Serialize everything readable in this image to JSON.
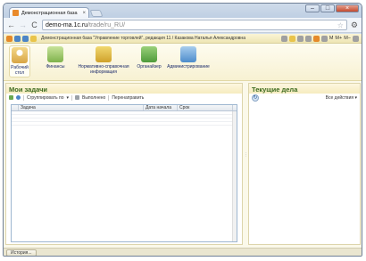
{
  "browser": {
    "tab_title": "Демонстрационная база",
    "tab_close": "×",
    "window_controls": {
      "minimize": "–",
      "maximize": "□",
      "close": "×"
    },
    "nav": {
      "back": "←",
      "forward": "→",
      "reload": "C"
    },
    "address": {
      "host": "demo-ma.1c.ru",
      "path": "/trade/ru_RU/"
    },
    "star": "☆",
    "menu": "⚙"
  },
  "app": {
    "title": "Демонстрационная база \"Управление торговлей\", редакция 11 / Казакова Наталья Александровна",
    "tool_letters": [
      "M",
      "M+",
      "M−"
    ],
    "sections": [
      {
        "id": "desk",
        "label": "Рабочий стол",
        "active": true
      },
      {
        "id": "fin",
        "label": "Финансы",
        "active": false
      },
      {
        "id": "ref",
        "label": "Нормативно-справочная информация",
        "active": false
      },
      {
        "id": "org",
        "label": "Органайзер",
        "active": false
      },
      {
        "id": "adm",
        "label": "Администрирование",
        "active": false
      }
    ]
  },
  "tasks": {
    "title": "Мои задачи",
    "group_by": "Сгруппировать по",
    "done": "Выполнено",
    "redirect": "Перенаправить",
    "columns": [
      "Задача",
      "Дата начала",
      "Срок"
    ]
  },
  "current": {
    "title": "Текущие дела",
    "all_actions": "Все действия"
  },
  "status": {
    "history": "История..."
  }
}
